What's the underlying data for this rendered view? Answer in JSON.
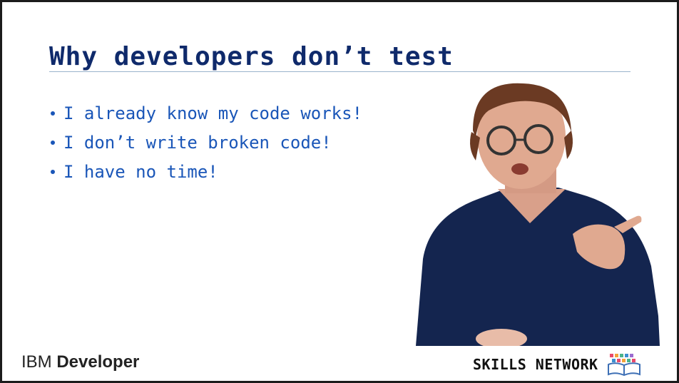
{
  "slide": {
    "title": "Why developers don’t test",
    "bullets": [
      "I already know my code works!",
      "I don’t write broken code!",
      "I have no time!"
    ]
  },
  "footer": {
    "brand_prefix": "IBM",
    "brand_name": "Developer",
    "network_label": "SKILLS NETWORK"
  },
  "colors": {
    "title": "#0f2a6b",
    "bullet_text": "#1a56b8",
    "rule": "#9ab4cc",
    "sweater": "#14254f"
  },
  "icons": [
    "bullet-dot-icon",
    "skills-network-book-icon"
  ]
}
